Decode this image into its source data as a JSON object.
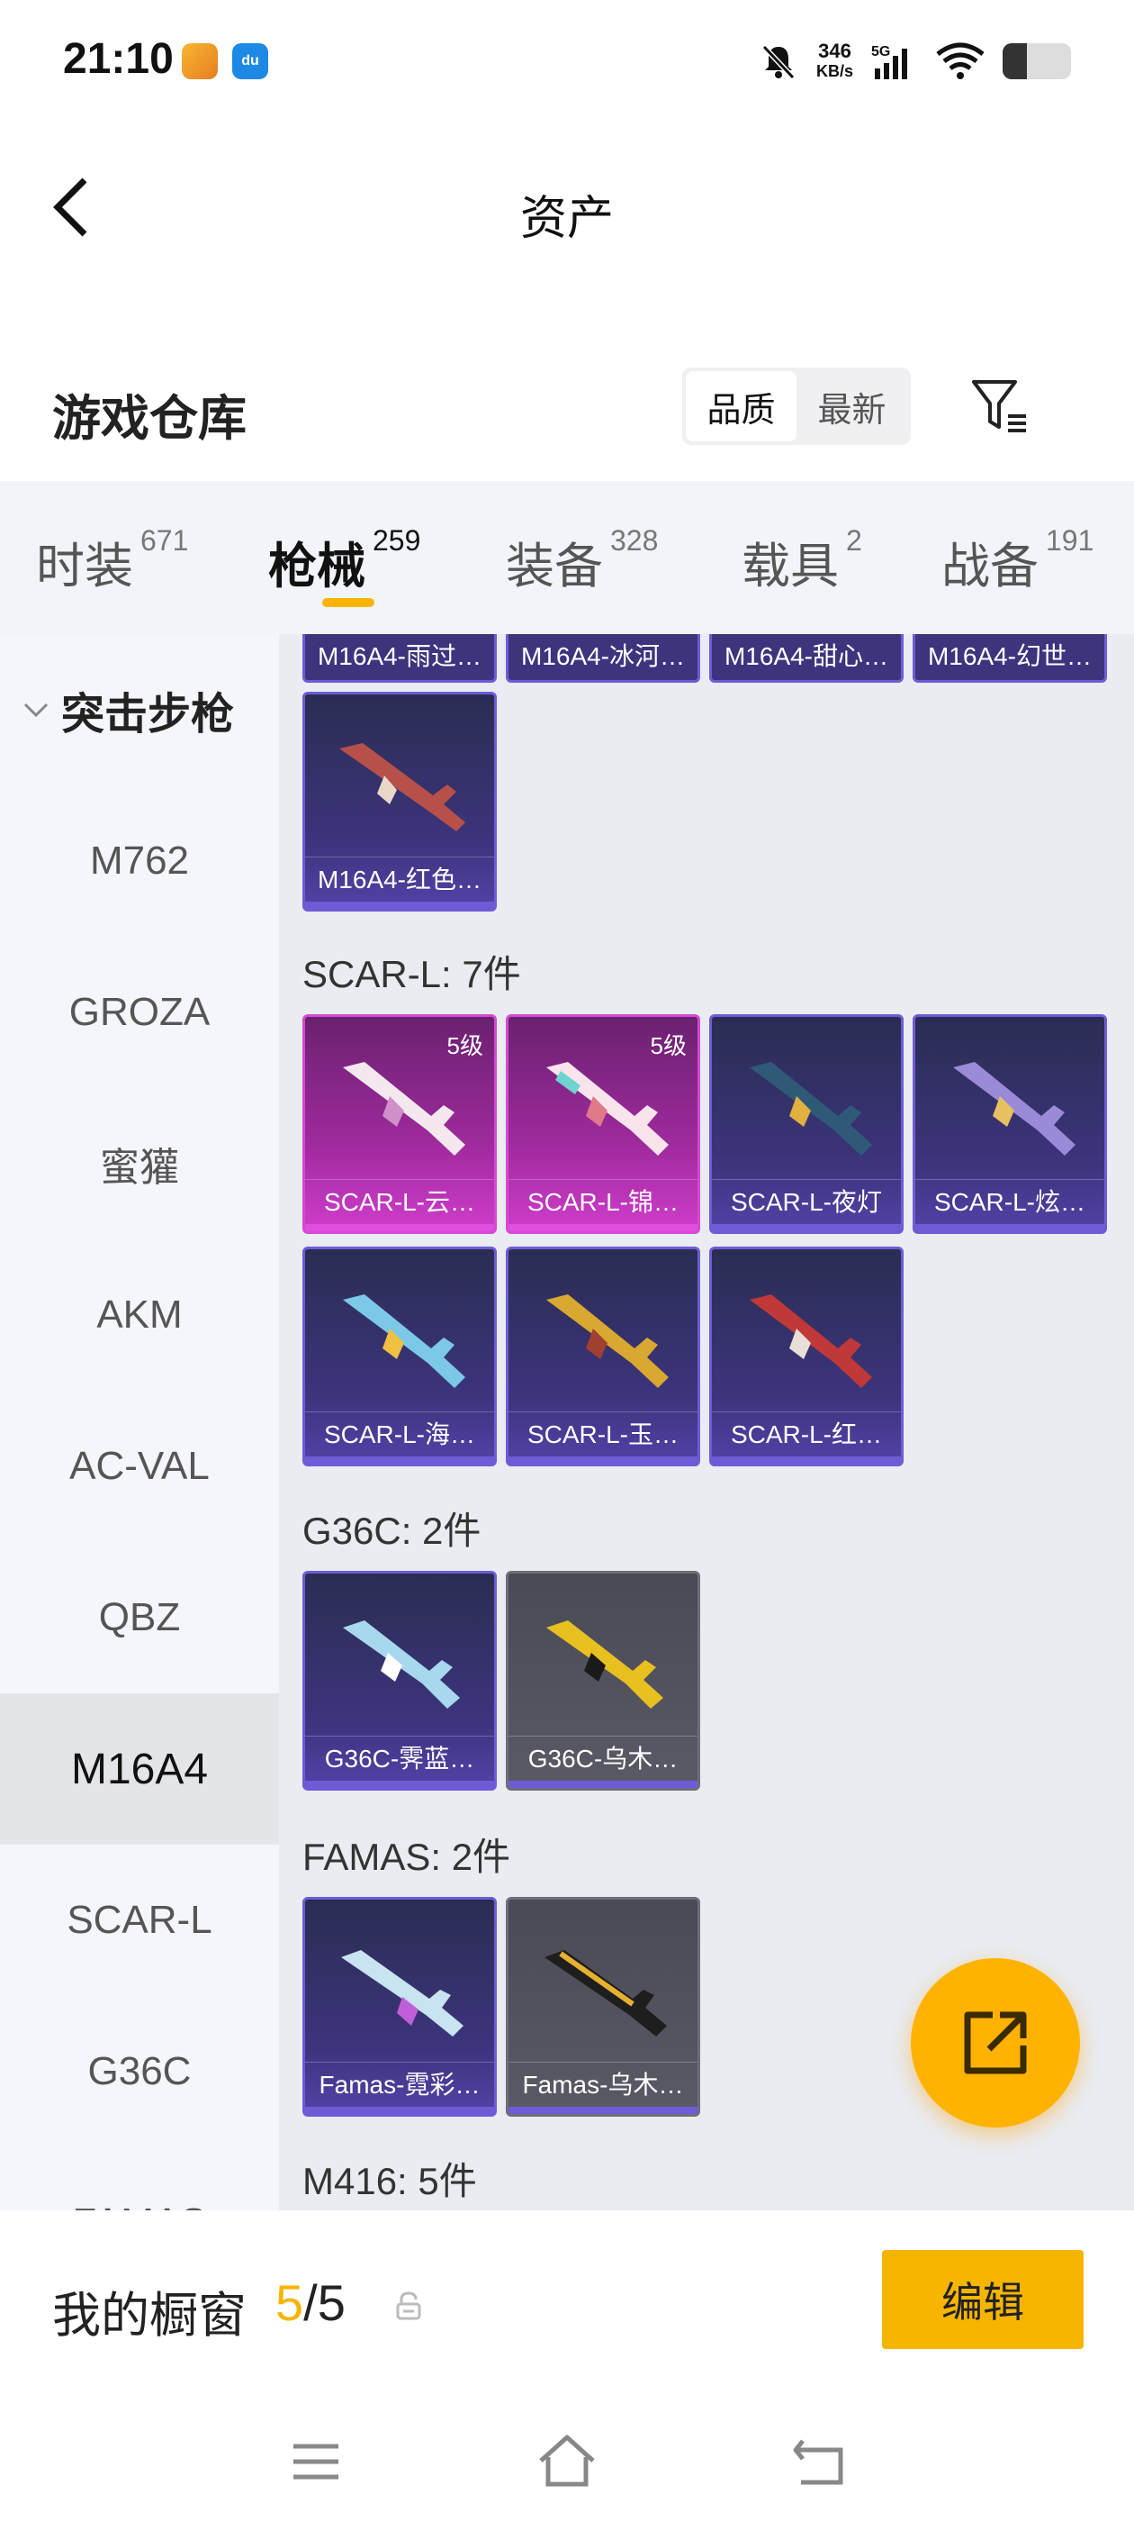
{
  "status_bar": {
    "time": "21:10",
    "app_badge_1": "和平精英",
    "app_badge_2": "du",
    "net_speed_value": "346",
    "net_speed_unit": "KB/s",
    "network": "5G",
    "battery_level": 0.35
  },
  "header": {
    "title": "资产"
  },
  "warehouse": {
    "title": "游戏仓库",
    "sort_options": [
      "品质",
      "最新"
    ],
    "sort_selected": "品质"
  },
  "tabs": [
    {
      "label": "时装",
      "count": "671"
    },
    {
      "label": "枪械",
      "count": "259",
      "active": true
    },
    {
      "label": "装备",
      "count": "328"
    },
    {
      "label": "载具",
      "count": "2"
    },
    {
      "label": "战备",
      "count": "191"
    }
  ],
  "sidebar": {
    "group_label": "突击步枪",
    "items": [
      "M762",
      "GROZA",
      "蜜獾",
      "AKM",
      "AC-VAL",
      "QBZ",
      "M16A4",
      "SCAR-L",
      "G36C",
      "FAMAS"
    ],
    "active_item": "M16A4"
  },
  "sections": {
    "m16a4_partial": [
      "M16A4-雨过…",
      "M16A4-冰河…",
      "M16A4-甜心…",
      "M16A4-幻世…"
    ],
    "m16a4_last": "M16A4-红色…",
    "scar": {
      "title": "SCAR-L: 7件",
      "items": [
        {
          "label": "SCAR-L-云…",
          "level": "5级",
          "rarity": "pink"
        },
        {
          "label": "SCAR-L-锦…",
          "level": "5级",
          "rarity": "pink"
        },
        {
          "label": "SCAR-L-夜灯",
          "rarity": "purple"
        },
        {
          "label": "SCAR-L-炫…",
          "rarity": "purple"
        },
        {
          "label": "SCAR-L-海…",
          "rarity": "purple"
        },
        {
          "label": "SCAR-L-玉…",
          "rarity": "purple"
        },
        {
          "label": "SCAR-L-红…",
          "rarity": "purple"
        }
      ]
    },
    "g36c": {
      "title": "G36C: 2件",
      "items": [
        {
          "label": "G36C-霁蓝…",
          "rarity": "purple"
        },
        {
          "label": "G36C-乌木…",
          "rarity": "gray"
        }
      ]
    },
    "famas": {
      "title": "FAMAS: 2件",
      "items": [
        {
          "label": "Famas-霓彩…",
          "rarity": "purple"
        },
        {
          "label": "Famas-乌木…",
          "rarity": "gray"
        }
      ]
    },
    "m416": {
      "title": "M416: 5件"
    }
  },
  "showcase": {
    "label": "我的橱窗",
    "current": "5",
    "separator": "/",
    "total": "5",
    "edit_label": "编辑"
  },
  "colors": {
    "accent": "#f7b500",
    "fab": "#ffb300",
    "rarity_purple": "#6e5cd6",
    "rarity_pink": "#d54ad0"
  }
}
